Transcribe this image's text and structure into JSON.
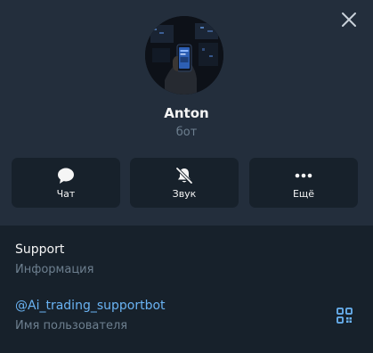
{
  "profile": {
    "name": "Anton",
    "subtitle": "бот"
  },
  "actions": [
    {
      "label": "Чат",
      "icon": "chat-bubble-icon"
    },
    {
      "label": "Звук",
      "icon": "bell-muted-icon"
    },
    {
      "label": "Ещё",
      "icon": "more-dots-icon"
    }
  ],
  "info": {
    "about_value": "Support",
    "about_caption": "Информация",
    "username_value": "@Ai_trading_supportbot",
    "username_caption": "Имя пользователя"
  },
  "icons": {
    "close": "close-icon",
    "qr": "qr-code-icon"
  },
  "colors": {
    "header_bg": "#232e3c",
    "body_bg": "#17212b",
    "link": "#6ab3f3",
    "muted": "#6d7f8f"
  }
}
